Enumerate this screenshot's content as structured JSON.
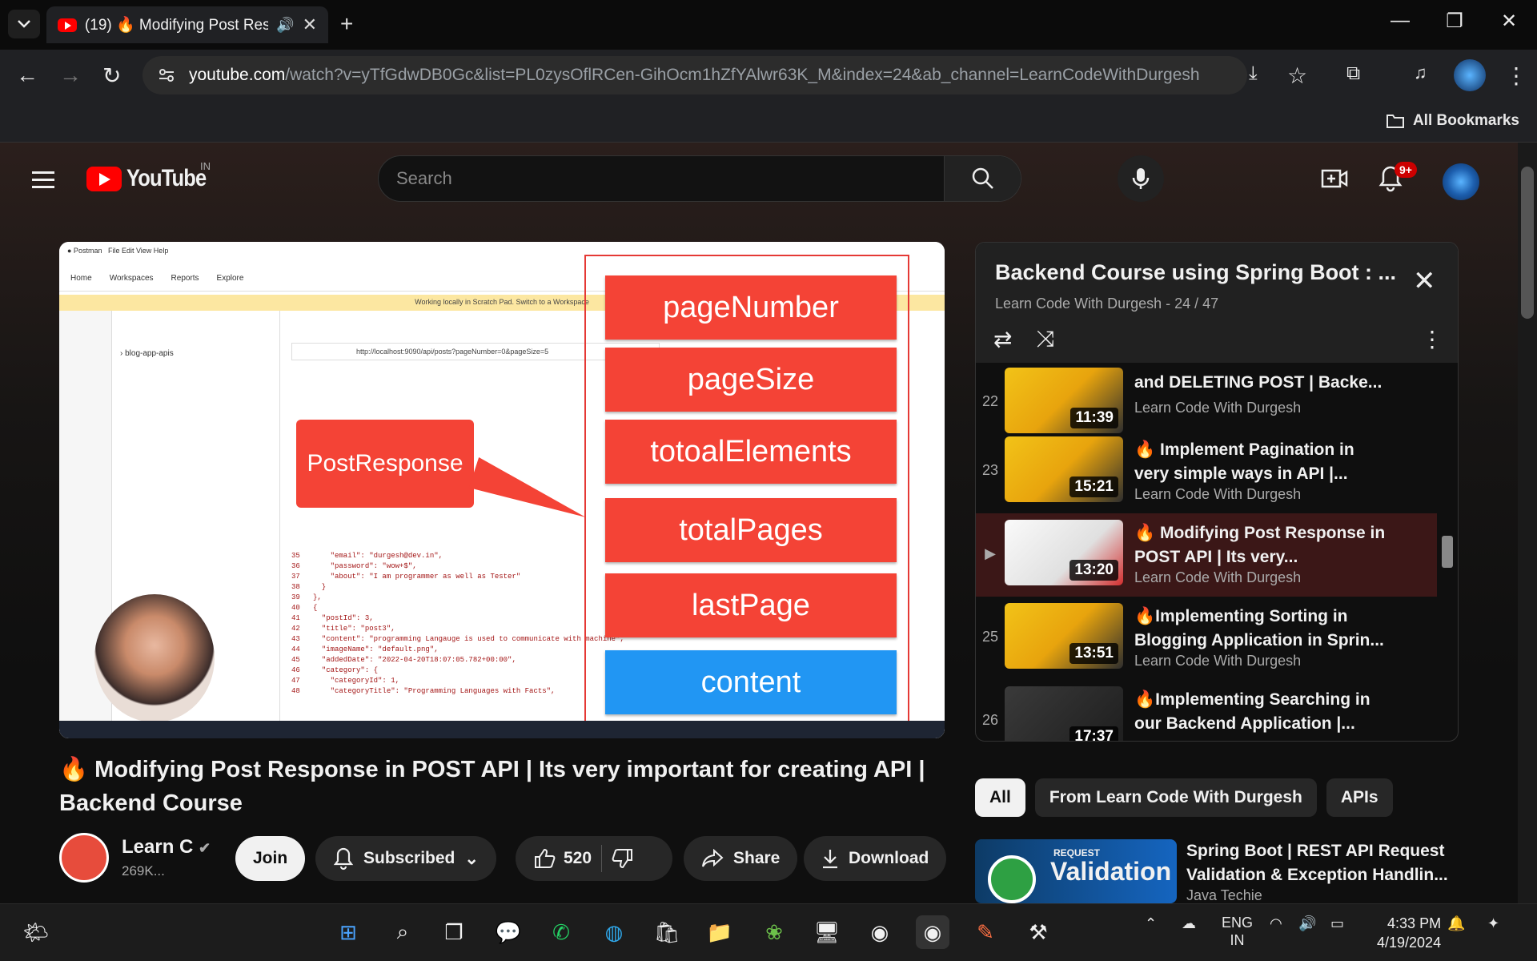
{
  "browser": {
    "tab_title": "(19) 🔥 Modifying Post Res",
    "url_host": "youtube.com",
    "url_path": "/watch?v=yTfGdwDB0Gc&list=PL0zysOflRCen-GihOcm1hZfYAlwr63K_M&index=24&ab_channel=LearnCodeWithDurgesh",
    "all_bookmarks": "All Bookmarks"
  },
  "youtube": {
    "logo_text": "YouTube",
    "country": "IN",
    "search_placeholder": "Search",
    "notif_badge": "9+"
  },
  "video": {
    "title": "🔥 Modifying Post Response in POST API | Its very important for creating API | Backend Course",
    "callout": "PostResponse",
    "fields": [
      "pageNumber",
      "pageSize",
      "totoalElements",
      "totalPages",
      "lastPage",
      "content"
    ],
    "postman_nav": [
      "Home",
      "Workspaces",
      "Reports",
      "Explore"
    ],
    "postman_banner": "Working locally in Scratch Pad. Switch to a Workspace",
    "postman_url": "http://localhost:9090/api/posts?pageNumber=0&pageSize=5",
    "postman_tree": "blog-app-apis",
    "code": "35       \"email\": \"durgesh@dev.in\",\n36       \"password\": \"wow+$\",\n37       \"about\": \"I am programmer as well as Tester\"\n38     }\n39   },\n40   {\n41     \"postId\": 3,\n42     \"title\": \"post3\",\n43     \"content\": \"programming Langauge is used to communicate with machine\",\n44     \"imageName\": \"default.png\",\n45     \"addedDate\": \"2022-04-20T18:07:05.782+00:00\",\n46     \"category\": {\n47       \"categoryId\": 1,\n48       \"categoryTitle\": \"Programming Languages with Facts\","
  },
  "channel": {
    "name": "Learn C",
    "subs": "269K...",
    "join": "Join",
    "subscribed": "Subscribed",
    "likes": "520",
    "share": "Share",
    "download": "Download"
  },
  "playlist": {
    "title": "Backend Course using Spring Boot : ...",
    "subtitle": "Learn Code With Durgesh - 24 / 47",
    "items": [
      {
        "num": "22",
        "title": "and DELETING POST | Backe...",
        "channel": "Learn Code With Durgesh",
        "duration": "11:39",
        "thumb": "yellow"
      },
      {
        "num": "23",
        "title": "🔥 Implement Pagination in very simple ways in API |...",
        "channel": "Learn Code With Durgesh",
        "duration": "15:21",
        "thumb": "yellow"
      },
      {
        "num": "▶",
        "title": "🔥 Modifying Post Response in POST API | Its very...",
        "channel": "Learn Code With Durgesh",
        "duration": "13:20",
        "thumb": "white"
      },
      {
        "num": "25",
        "title": "🔥Implementing Sorting in Blogging Application in Sprin...",
        "channel": "Learn Code With Durgesh",
        "duration": "13:51",
        "thumb": "yellow"
      },
      {
        "num": "26",
        "title": "🔥Implementing Searching in our Backend Application |...",
        "channel": "",
        "duration": "17:37",
        "thumb": "dark"
      }
    ]
  },
  "chips": [
    "All",
    "From Learn Code With Durgesh",
    "APIs"
  ],
  "recommendation": {
    "thumb_line1": "REQUEST",
    "thumb_line2": "Validation",
    "title": "Spring Boot | REST API Request Validation & Exception Handlin...",
    "channel": "Java Techie"
  },
  "taskbar": {
    "lang1": "ENG",
    "lang2": "IN",
    "time": "4:33 PM",
    "date": "4/19/2024"
  }
}
